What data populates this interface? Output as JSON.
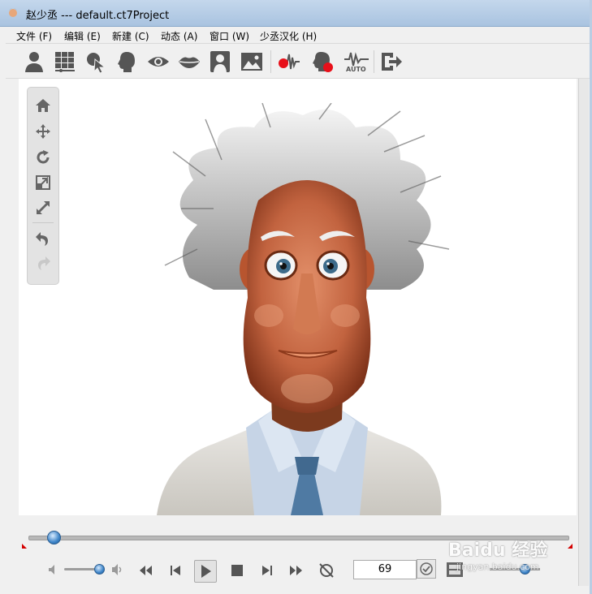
{
  "window": {
    "title": "赵少丞 --- default.ct7Project"
  },
  "menu": [
    {
      "label": "文件 (F)"
    },
    {
      "label": "编辑 (E)"
    },
    {
      "label": "新建 (C)"
    },
    {
      "label": "动态 (A)"
    },
    {
      "label": "窗口 (W)"
    },
    {
      "label": "少丞汉化 (H)"
    }
  ],
  "toolbar": {
    "buttons": [
      {
        "icon": "actor-icon"
      },
      {
        "icon": "grid-icon"
      },
      {
        "icon": "select-pointer-icon"
      },
      {
        "icon": "head-icon"
      },
      {
        "icon": "eye-icon"
      },
      {
        "icon": "lips-icon"
      },
      {
        "icon": "portrait-icon"
      },
      {
        "icon": "image-icon"
      },
      {
        "icon": "record-audio-icon"
      },
      {
        "icon": "record-face-icon"
      },
      {
        "icon": "auto-lipsync-icon",
        "text": "AUTO"
      },
      {
        "icon": "export-icon"
      }
    ]
  },
  "viewtools": [
    "home-icon",
    "move-icon",
    "rotate-icon",
    "fit-icon",
    "zoom-icon",
    "undo-icon",
    "redo-icon"
  ],
  "playback": {
    "timeline_progress": 0.045,
    "volume_level": 0.85,
    "frame": "69",
    "zoom_level": 0.7
  },
  "watermark": {
    "brand": "Baidu",
    "sub": "jingyan.baidu.com"
  },
  "colors": {
    "record_red": "#e8101a",
    "accent_blue": "#3d84c8"
  }
}
